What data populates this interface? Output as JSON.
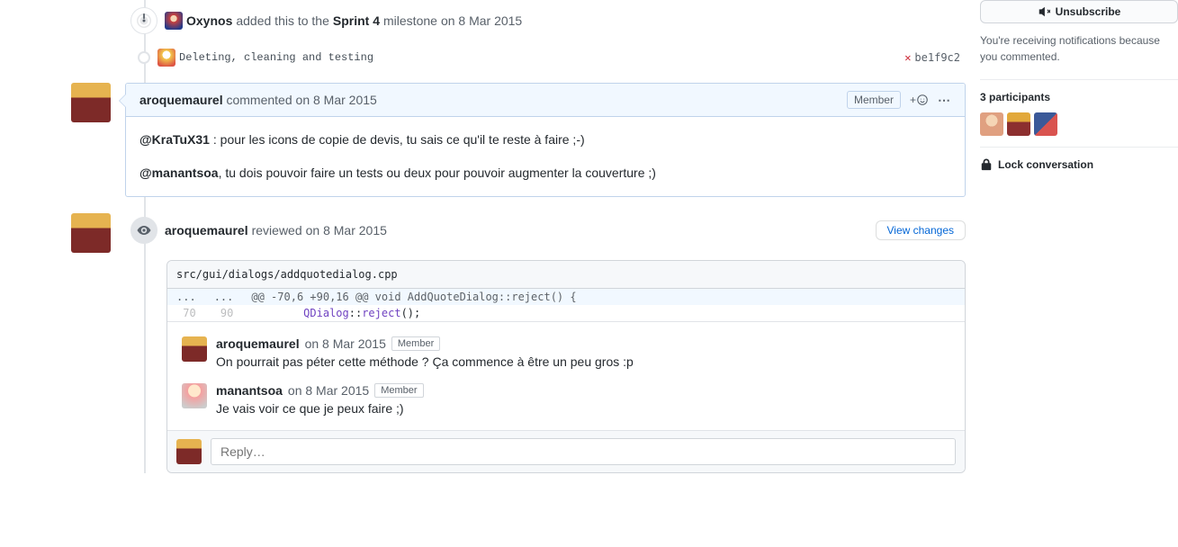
{
  "timeline_line_start_offset": 0,
  "milestone_event": {
    "actor": "Oxynos",
    "action": "added this to the",
    "milestone": "Sprint 4",
    "suffix": "milestone",
    "date": "on 8 Mar 2015"
  },
  "commit_event": {
    "message": "Deleting, cleaning and testing",
    "sha": "be1f9c2",
    "status_icon": "✕"
  },
  "comment": {
    "author": "aroquemaurel",
    "action": "commented",
    "date": "on 8 Mar 2015",
    "badge": "Member",
    "body_p1_mention": "@KraTuX31",
    "body_p1_rest": " : pour les icons de copie de devis, tu sais ce qu'il te reste à faire ;-)",
    "body_p2_mention": "@manantsoa",
    "body_p2_rest": ", tu dois pouvoir faire un tests ou deux pour pouvoir augmenter la couverture ;)"
  },
  "review": {
    "author": "aroquemaurel",
    "action": "reviewed",
    "date": "on 8 Mar 2015",
    "view_changes": "View changes",
    "file": "src/gui/dialogs/addquotedialog.cpp",
    "hunk_dots": "...",
    "hunk_header": "@@ -70,6 +90,16 @@ void AddQuoteDialog::reject() {",
    "line_old": "70",
    "line_new": "90",
    "code_indent": "        ",
    "code_class1": "QDialog",
    "code_sep": "::",
    "code_class2": "reject",
    "code_tail": "();",
    "comments": [
      {
        "author": "aroquemaurel",
        "date": "on 8 Mar 2015",
        "badge": "Member",
        "text": "On pourrait pas péter cette méthode ? Ça commence à être un peu gros :p",
        "avatar_class": "av-aroque"
      },
      {
        "author": "manantsoa",
        "date": "on 8 Mar 2015",
        "badge": "Member",
        "text": "Je vais voir ce que je peux faire ;)",
        "avatar_class": "av-manantsoa"
      }
    ],
    "reply_placeholder": "Reply…"
  },
  "sidebar": {
    "unsubscribe": "Unsubscribe",
    "note": "You're receiving notifications because you commented.",
    "participants_heading": "3 participants",
    "lock_label": "Lock conversation"
  }
}
